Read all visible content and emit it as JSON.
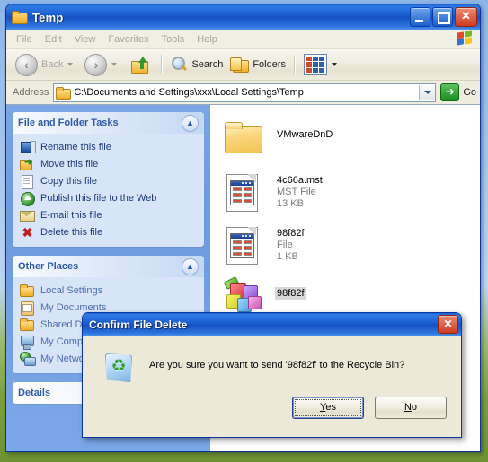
{
  "window": {
    "title": "Temp",
    "icon": "folder-icon",
    "controls": {
      "minimize": "minimize-button",
      "maximize": "maximize-button",
      "close": "close-button"
    }
  },
  "menubar": {
    "items": [
      "File",
      "Edit",
      "View",
      "Favorites",
      "Tools",
      "Help"
    ]
  },
  "toolbar": {
    "back_label": "Back",
    "search_label": "Search",
    "folders_label": "Folders"
  },
  "address": {
    "label": "Address",
    "value": "C:\\Documents and Settings\\xxx\\Local Settings\\Temp",
    "go_label": "Go"
  },
  "sidebar": {
    "tasks_panel": {
      "title": "File and Folder Tasks",
      "items": [
        {
          "label": "Rename this file",
          "icon": "rename-icon"
        },
        {
          "label": "Move this file",
          "icon": "move-icon"
        },
        {
          "label": "Copy this file",
          "icon": "copy-icon"
        },
        {
          "label": "Publish this file to the Web",
          "icon": "publish-icon"
        },
        {
          "label": "E-mail this file",
          "icon": "email-icon"
        },
        {
          "label": "Delete this file",
          "icon": "delete-icon"
        }
      ]
    },
    "other_places_panel": {
      "title": "Other Places",
      "items": [
        {
          "label": "Local Settings",
          "icon": "folder-icon"
        },
        {
          "label": "My Documents",
          "icon": "my-documents-icon"
        },
        {
          "label": "Shared Documents",
          "icon": "folder-icon"
        },
        {
          "label": "My Computer",
          "icon": "my-computer-icon"
        },
        {
          "label": "My Network Places",
          "icon": "network-icon"
        }
      ]
    },
    "details_panel": {
      "title": "Details"
    }
  },
  "filelist": {
    "items": [
      {
        "name": "VMwareDnD",
        "type": "",
        "size": "",
        "icon": "folder-icon",
        "selected": false
      },
      {
        "name": "4c66a.mst",
        "type": "MST File",
        "size": "13 KB",
        "icon": "document-icon",
        "selected": false
      },
      {
        "name": "98f82f",
        "type": "File",
        "size": "1 KB",
        "icon": "document-icon",
        "selected": false
      },
      {
        "name": "98f82f",
        "type": "",
        "size": "",
        "icon": "blocks-icon",
        "selected": true
      }
    ]
  },
  "dialog": {
    "title": "Confirm File Delete",
    "icon": "recycle-bin-icon",
    "message": "Are you sure you want to send '98f82f' to the Recycle Bin?",
    "buttons": {
      "yes": "Yes",
      "no": "No"
    }
  },
  "colors": {
    "title_blue": "#1b5fd2",
    "sidebar_blue": "#7ba4e3",
    "panel_body": "#d8e5f8",
    "panel_title_text": "#2f5aa8",
    "dialog_face": "#ece9d8",
    "selection_grey": "#d8d8d8"
  }
}
